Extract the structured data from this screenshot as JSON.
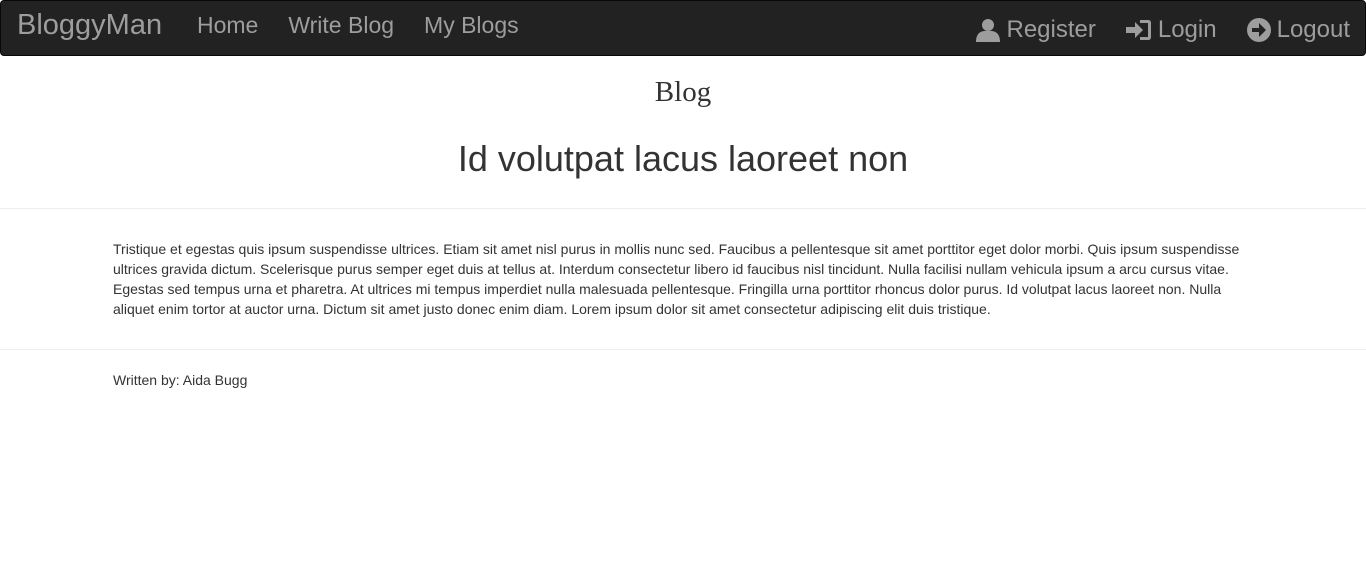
{
  "navbar": {
    "brand": "BloggyMan",
    "left_links": [
      {
        "label": "Home"
      },
      {
        "label": "Write Blog"
      },
      {
        "label": "My Blogs"
      }
    ],
    "right_links": [
      {
        "label": "Register",
        "icon": "user-icon"
      },
      {
        "label": "Login",
        "icon": "login-icon"
      },
      {
        "label": "Logout",
        "icon": "logout-icon"
      }
    ],
    "colors": {
      "background": "#222222",
      "link": "#9d9d9d"
    }
  },
  "page": {
    "heading": "Blog"
  },
  "post": {
    "title": "Id volutpat lacus laoreet non",
    "body": "Tristique et egestas quis ipsum suspendisse ultrices. Etiam sit amet nisl purus in mollis nunc sed. Faucibus a pellentesque sit amet porttitor eget dolor morbi. Quis ipsum suspendisse ultrices gravida dictum. Scelerisque purus semper eget duis at tellus at. Interdum consectetur libero id faucibus nisl tincidunt. Nulla facilisi nullam vehicula ipsum a arcu cursus vitae. Egestas sed tempus urna et pharetra. At ultrices mi tempus imperdiet nulla malesuada pellentesque. Fringilla urna porttitor rhoncus dolor purus. Id volutpat lacus laoreet non. Nulla aliquet enim tortor at auctor urna. Dictum sit amet justo donec enim diam. Lorem ipsum dolor sit amet consectetur adipiscing elit duis tristique.",
    "author_line": "Written by: Aida Bugg"
  }
}
